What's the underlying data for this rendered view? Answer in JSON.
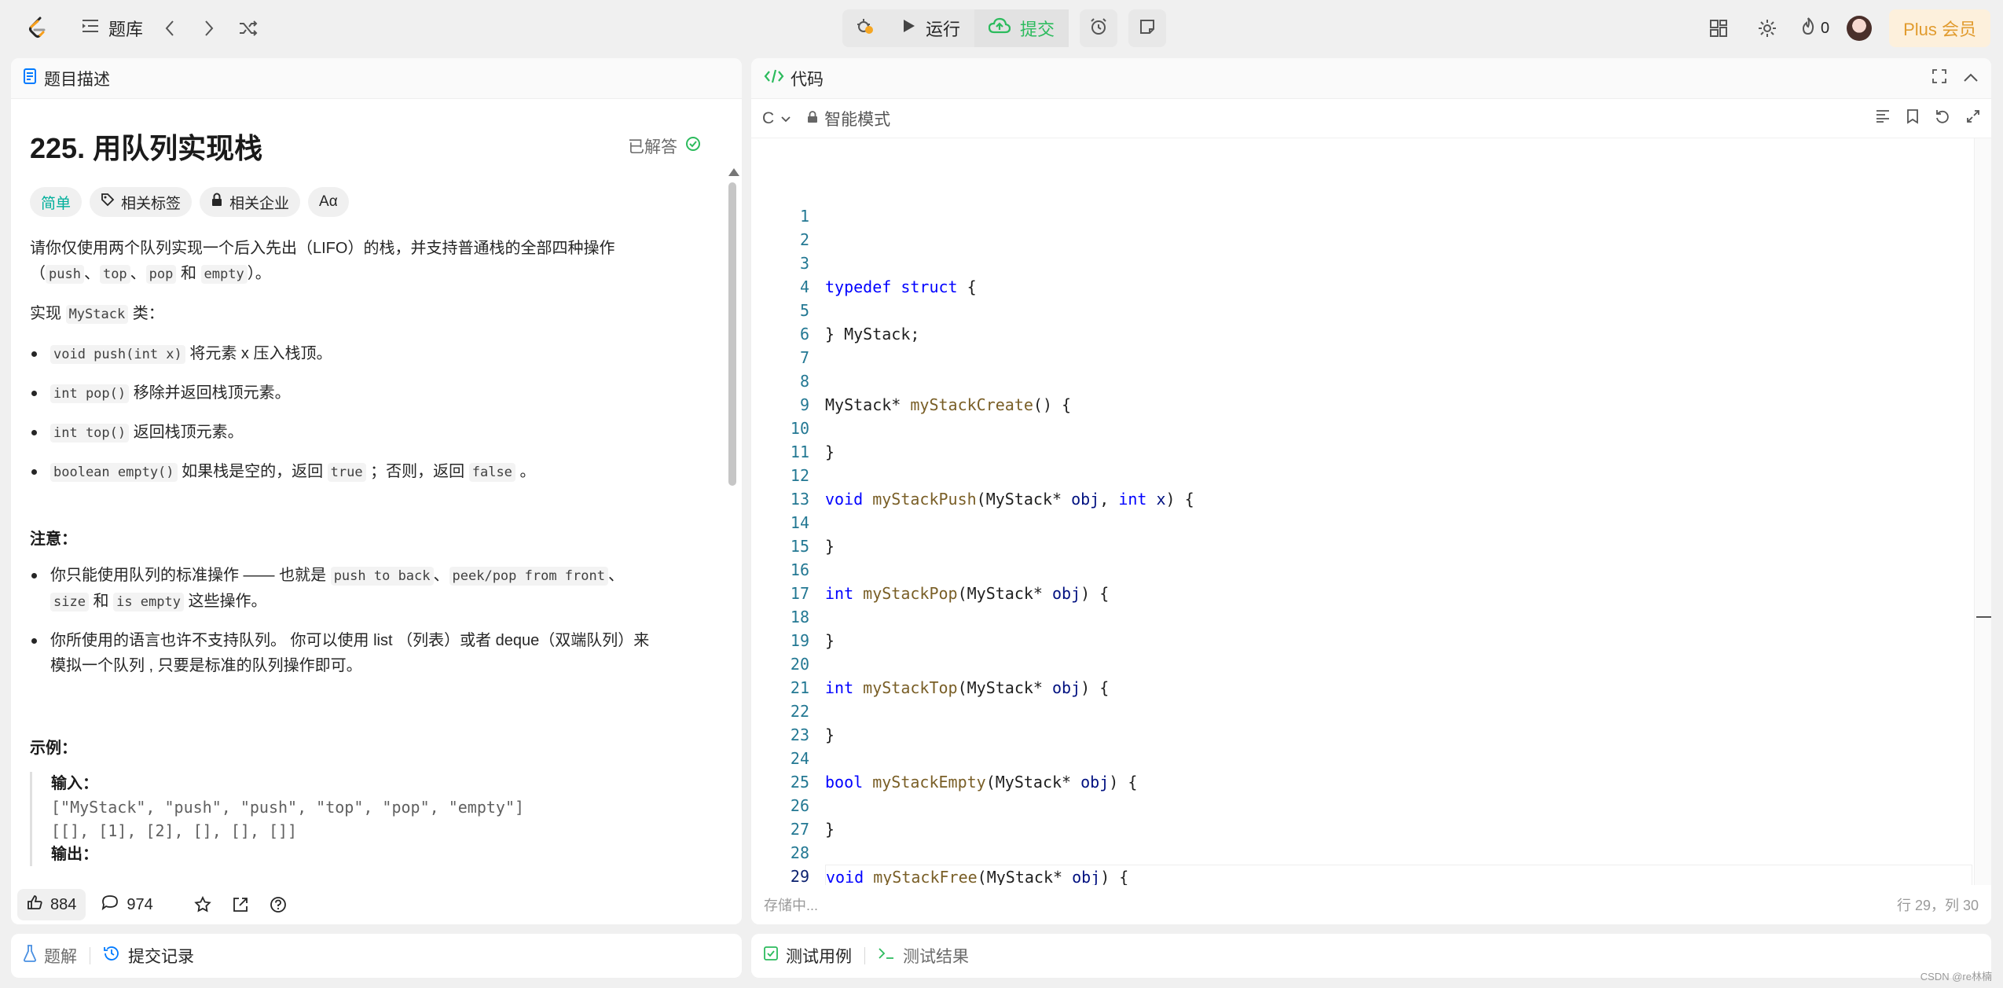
{
  "nav": {
    "problem_bank": "题库",
    "run": "运行",
    "submit": "提交",
    "streak": "0",
    "plus": "Plus 会员"
  },
  "desc": {
    "tab": "题目描述",
    "title": "225. 用队列实现栈",
    "solved": "已解答",
    "tags": {
      "difficulty": "简单",
      "topics": "相关标签",
      "companies": "相关企业",
      "translate": "Aα"
    },
    "intro_1": "请你仅使用两个队列实现一个后入先出（LIFO）的栈，并支持普通栈的全部四种操作",
    "intro_2_open": "（",
    "ops": [
      "push",
      "top",
      "pop",
      "empty"
    ],
    "sep": "、",
    "and": "和",
    "intro_2_close": "）。",
    "impl_prefix": "实现",
    "impl_class": "MyStack",
    "impl_suffix": "类：",
    "methods": [
      {
        "code": "void push(int x)",
        "text": "将元素 x 压入栈顶。"
      },
      {
        "code": "int pop()",
        "text": "移除并返回栈顶元素。"
      },
      {
        "code": "int top()",
        "text": "返回栈顶元素。"
      }
    ],
    "empty_method": {
      "code": "boolean empty()",
      "text1": "如果栈是空的，返回",
      "true_val": "true",
      "text2": "；否则，返回",
      "false_val": "false",
      "text3": "。"
    },
    "note_heading": "注意：",
    "note1": {
      "prefix": "你只能使用队列的标准操作 —— 也就是",
      "c1": "push to back",
      "c2": "peek/pop from front",
      "c3": "size",
      "and": "和",
      "c4": "is empty",
      "suffix": "这些操作。"
    },
    "note2_line1": "你所使用的语言也许不支持队列。 你可以使用 list （列表）或者 deque（双端队列）来",
    "note2_line2": "模拟一个队列 , 只要是标准的队列操作即可。",
    "example_heading": "示例：",
    "input_label": "输入：",
    "input_line1": "[\"MyStack\", \"push\", \"push\", \"top\", \"pop\", \"empty\"]",
    "input_line2": "[[], [1], [2], [], [], []]",
    "output_label": "输出："
  },
  "footer": {
    "likes": "884",
    "comments": "974"
  },
  "left_tabs": {
    "solutions": "题解",
    "submissions": "提交记录"
  },
  "code": {
    "tab": "代码",
    "language": "C",
    "mode": "智能模式",
    "lines": [
      "",
      "",
      "",
      "typedef struct {",
      "",
      "} MyStack;",
      "",
      "",
      "MyStack* myStackCreate() {",
      "",
      "}",
      "",
      "void myStackPush(MyStack* obj, int x) {",
      "",
      "}",
      "",
      "int myStackPop(MyStack* obj) {",
      "",
      "}",
      "",
      "int myStackTop(MyStack* obj) {",
      "",
      "}",
      "",
      "bool myStackEmpty(MyStack* obj) {",
      "",
      "}",
      "",
      "void myStackFree(MyStack* obj) {",
      "",
      "}"
    ],
    "saving": "存储中...",
    "cursor": "行 29，列 30"
  },
  "right_tabs": {
    "testcase": "测试用例",
    "result": "测试结果"
  },
  "watermark": "CSDN @re林楠",
  "colors": {
    "accent_green": "#2cbb5d",
    "easy": "#00af9b",
    "plus": "#e19b2e",
    "keyword": "#0000ff",
    "function": "#795e26",
    "param": "#001080"
  }
}
